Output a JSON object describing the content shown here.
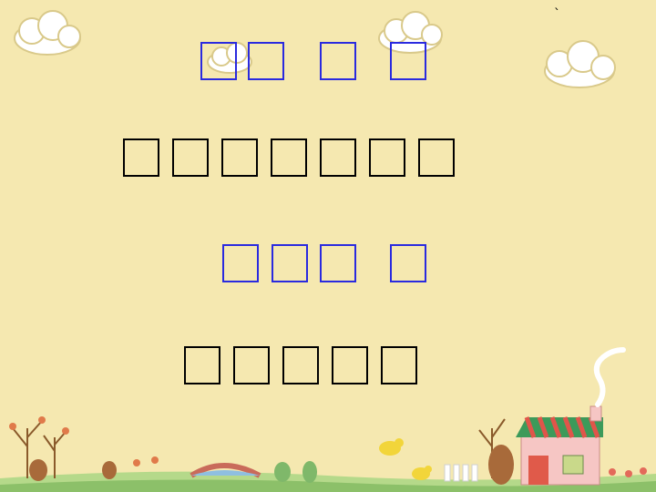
{
  "slide": {
    "line1": "□□ □ □",
    "line2": "□□□□□□□",
    "line3": "□□□ □",
    "line4": "□□□□□",
    "corner_mark": "`"
  },
  "colors": {
    "background": "#f5e8b0",
    "blue_text": "#2a2adf",
    "black_text": "#000000"
  }
}
